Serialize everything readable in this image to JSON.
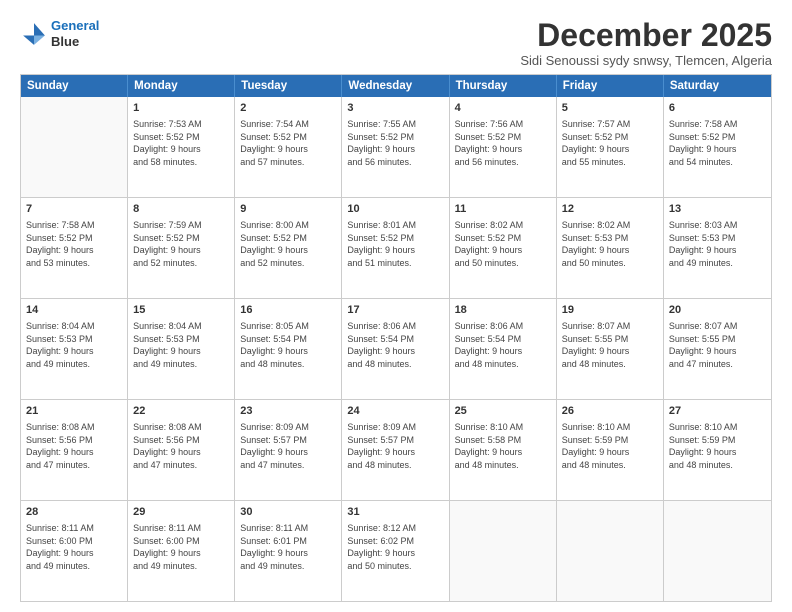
{
  "logo": {
    "line1": "General",
    "line2": "Blue"
  },
  "title": "December 2025",
  "subtitle": "Sidi Senoussi sydy snwsy, Tlemcen, Algeria",
  "header_days": [
    "Sunday",
    "Monday",
    "Tuesday",
    "Wednesday",
    "Thursday",
    "Friday",
    "Saturday"
  ],
  "weeks": [
    [
      {
        "day": "",
        "info": ""
      },
      {
        "day": "1",
        "info": "Sunrise: 7:53 AM\nSunset: 5:52 PM\nDaylight: 9 hours\nand 58 minutes."
      },
      {
        "day": "2",
        "info": "Sunrise: 7:54 AM\nSunset: 5:52 PM\nDaylight: 9 hours\nand 57 minutes."
      },
      {
        "day": "3",
        "info": "Sunrise: 7:55 AM\nSunset: 5:52 PM\nDaylight: 9 hours\nand 56 minutes."
      },
      {
        "day": "4",
        "info": "Sunrise: 7:56 AM\nSunset: 5:52 PM\nDaylight: 9 hours\nand 56 minutes."
      },
      {
        "day": "5",
        "info": "Sunrise: 7:57 AM\nSunset: 5:52 PM\nDaylight: 9 hours\nand 55 minutes."
      },
      {
        "day": "6",
        "info": "Sunrise: 7:58 AM\nSunset: 5:52 PM\nDaylight: 9 hours\nand 54 minutes."
      }
    ],
    [
      {
        "day": "7",
        "info": "Sunrise: 7:58 AM\nSunset: 5:52 PM\nDaylight: 9 hours\nand 53 minutes."
      },
      {
        "day": "8",
        "info": "Sunrise: 7:59 AM\nSunset: 5:52 PM\nDaylight: 9 hours\nand 52 minutes."
      },
      {
        "day": "9",
        "info": "Sunrise: 8:00 AM\nSunset: 5:52 PM\nDaylight: 9 hours\nand 52 minutes."
      },
      {
        "day": "10",
        "info": "Sunrise: 8:01 AM\nSunset: 5:52 PM\nDaylight: 9 hours\nand 51 minutes."
      },
      {
        "day": "11",
        "info": "Sunrise: 8:02 AM\nSunset: 5:52 PM\nDaylight: 9 hours\nand 50 minutes."
      },
      {
        "day": "12",
        "info": "Sunrise: 8:02 AM\nSunset: 5:53 PM\nDaylight: 9 hours\nand 50 minutes."
      },
      {
        "day": "13",
        "info": "Sunrise: 8:03 AM\nSunset: 5:53 PM\nDaylight: 9 hours\nand 49 minutes."
      }
    ],
    [
      {
        "day": "14",
        "info": "Sunrise: 8:04 AM\nSunset: 5:53 PM\nDaylight: 9 hours\nand 49 minutes."
      },
      {
        "day": "15",
        "info": "Sunrise: 8:04 AM\nSunset: 5:53 PM\nDaylight: 9 hours\nand 49 minutes."
      },
      {
        "day": "16",
        "info": "Sunrise: 8:05 AM\nSunset: 5:54 PM\nDaylight: 9 hours\nand 48 minutes."
      },
      {
        "day": "17",
        "info": "Sunrise: 8:06 AM\nSunset: 5:54 PM\nDaylight: 9 hours\nand 48 minutes."
      },
      {
        "day": "18",
        "info": "Sunrise: 8:06 AM\nSunset: 5:54 PM\nDaylight: 9 hours\nand 48 minutes."
      },
      {
        "day": "19",
        "info": "Sunrise: 8:07 AM\nSunset: 5:55 PM\nDaylight: 9 hours\nand 48 minutes."
      },
      {
        "day": "20",
        "info": "Sunrise: 8:07 AM\nSunset: 5:55 PM\nDaylight: 9 hours\nand 47 minutes."
      }
    ],
    [
      {
        "day": "21",
        "info": "Sunrise: 8:08 AM\nSunset: 5:56 PM\nDaylight: 9 hours\nand 47 minutes."
      },
      {
        "day": "22",
        "info": "Sunrise: 8:08 AM\nSunset: 5:56 PM\nDaylight: 9 hours\nand 47 minutes."
      },
      {
        "day": "23",
        "info": "Sunrise: 8:09 AM\nSunset: 5:57 PM\nDaylight: 9 hours\nand 47 minutes."
      },
      {
        "day": "24",
        "info": "Sunrise: 8:09 AM\nSunset: 5:57 PM\nDaylight: 9 hours\nand 48 minutes."
      },
      {
        "day": "25",
        "info": "Sunrise: 8:10 AM\nSunset: 5:58 PM\nDaylight: 9 hours\nand 48 minutes."
      },
      {
        "day": "26",
        "info": "Sunrise: 8:10 AM\nSunset: 5:59 PM\nDaylight: 9 hours\nand 48 minutes."
      },
      {
        "day": "27",
        "info": "Sunrise: 8:10 AM\nSunset: 5:59 PM\nDaylight: 9 hours\nand 48 minutes."
      }
    ],
    [
      {
        "day": "28",
        "info": "Sunrise: 8:11 AM\nSunset: 6:00 PM\nDaylight: 9 hours\nand 49 minutes."
      },
      {
        "day": "29",
        "info": "Sunrise: 8:11 AM\nSunset: 6:00 PM\nDaylight: 9 hours\nand 49 minutes."
      },
      {
        "day": "30",
        "info": "Sunrise: 8:11 AM\nSunset: 6:01 PM\nDaylight: 9 hours\nand 49 minutes."
      },
      {
        "day": "31",
        "info": "Sunrise: 8:12 AM\nSunset: 6:02 PM\nDaylight: 9 hours\nand 50 minutes."
      },
      {
        "day": "",
        "info": ""
      },
      {
        "day": "",
        "info": ""
      },
      {
        "day": "",
        "info": ""
      }
    ]
  ]
}
